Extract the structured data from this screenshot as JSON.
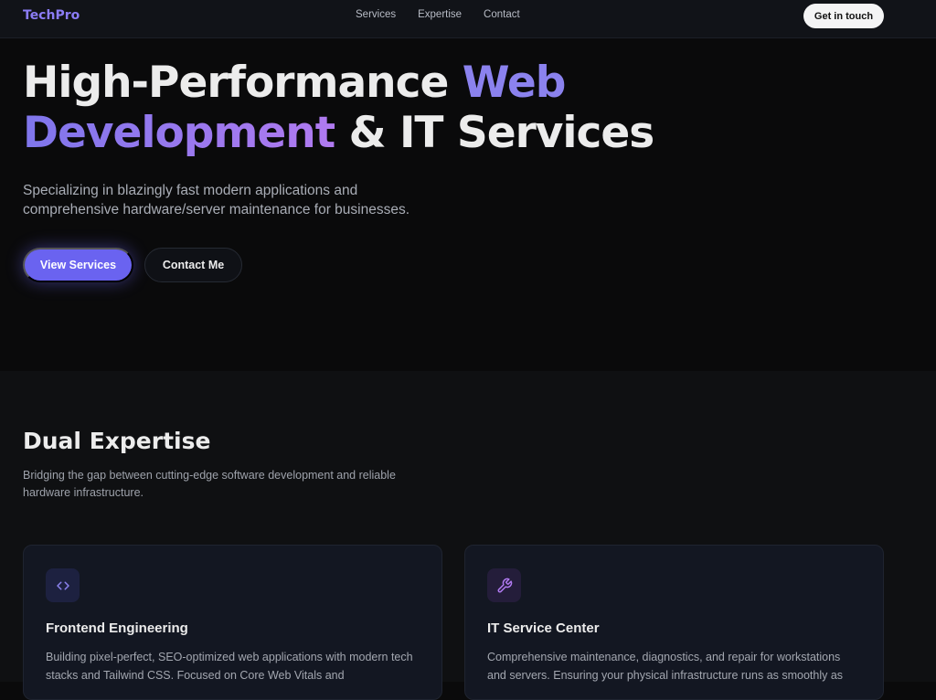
{
  "nav": {
    "logo": "TechPro",
    "links": [
      "Services",
      "Expertise",
      "Contact"
    ],
    "cta": "Get in touch"
  },
  "hero": {
    "title_part1": "High-Performance ",
    "title_highlight1": "Web",
    "title_highlight2": "Development",
    "title_part2": " & IT Services",
    "subtitle": "Specializing in blazingly fast modern applications and comprehensive hardware/server maintenance for businesses.",
    "primary_button": "View Services",
    "secondary_button": "Contact Me"
  },
  "expertise": {
    "title": "Dual Expertise",
    "subtitle": "Bridging the gap between cutting-edge software development and reliable hardware infrastructure.",
    "cards": [
      {
        "icon": "code-icon",
        "title": "Frontend Engineering",
        "description": "Building pixel-perfect, SEO-optimized web applications with modern tech stacks and Tailwind CSS. Focused on Core Web Vitals and"
      },
      {
        "icon": "wrench-icon",
        "title": "IT Service Center",
        "description": "Comprehensive maintenance, diagnostics, and repair for workstations and servers. Ensuring your physical infrastructure runs as smoothly as"
      }
    ]
  },
  "colors": {
    "accent": "#6a63f0",
    "highlight": "#8b82ee",
    "background": "#0a0a0b"
  }
}
